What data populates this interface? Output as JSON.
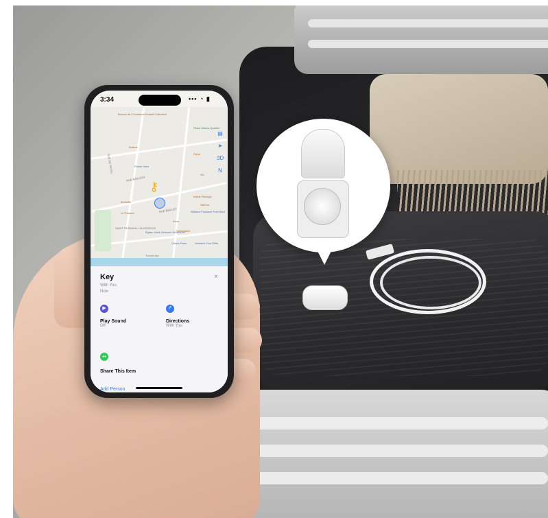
{
  "phone": {
    "status_time": "3:34",
    "status_icons": "••• ◔ ▮",
    "map": {
      "pois": [
        {
          "label": "Bourse de Commerce Pinault Collection",
          "cls": "poi"
        },
        {
          "label": "Place Wauvs Quartier",
          "cls": "poi poi-g"
        },
        {
          "label": "Aufeva",
          "cls": "poi"
        },
        {
          "label": "Pavet",
          "cls": "poi"
        },
        {
          "label": "Paniol Vues",
          "cls": "poi poi-b"
        },
        {
          "label": "Vio",
          "cls": "poi"
        },
        {
          "label": "BOWAB",
          "cls": "poi"
        },
        {
          "label": "Le Poisson",
          "cls": "poi"
        },
        {
          "label": "Mairie Rovulgo",
          "cls": "poi"
        },
        {
          "label": "Nahom",
          "cls": "poi"
        },
        {
          "label": "Wallace Fountain Pont Neuf",
          "cls": "poi poi-b"
        },
        {
          "label": "Kenz",
          "cls": "poi"
        },
        {
          "label": "Samaritaine",
          "cls": "poi"
        },
        {
          "label": "Église Saint-Germain l'Auxerrois",
          "cls": "poi poi-b"
        },
        {
          "label": "Chalet Paris",
          "cls": "poi poi-b"
        },
        {
          "label": "Vedettes Tour Eiffel",
          "cls": "poi poi-b"
        }
      ],
      "street_labels": [
        "RUE BAILLEUL",
        "RUE DE RIVOLI",
        "SAINT GERMAIN L'AUXERROIS",
        "RUE BAILLET",
        "Tunnel des"
      ],
      "controls": [
        "▤",
        "➤",
        "3D",
        "N"
      ]
    },
    "sheet": {
      "title": "Key",
      "subtitle": "With You",
      "subtitle2": "Now",
      "close": "×",
      "play_sound": {
        "label": "Play Sound",
        "sub": "Off",
        "icon": "▶",
        "color": "#5856d6"
      },
      "directions": {
        "label": "Directions",
        "sub": "With You",
        "icon": "↱",
        "color": "#3478f6"
      },
      "share": {
        "label": "Share This Item",
        "icon": "●●",
        "color": "#34c759"
      },
      "add_person": "Add Person"
    }
  }
}
